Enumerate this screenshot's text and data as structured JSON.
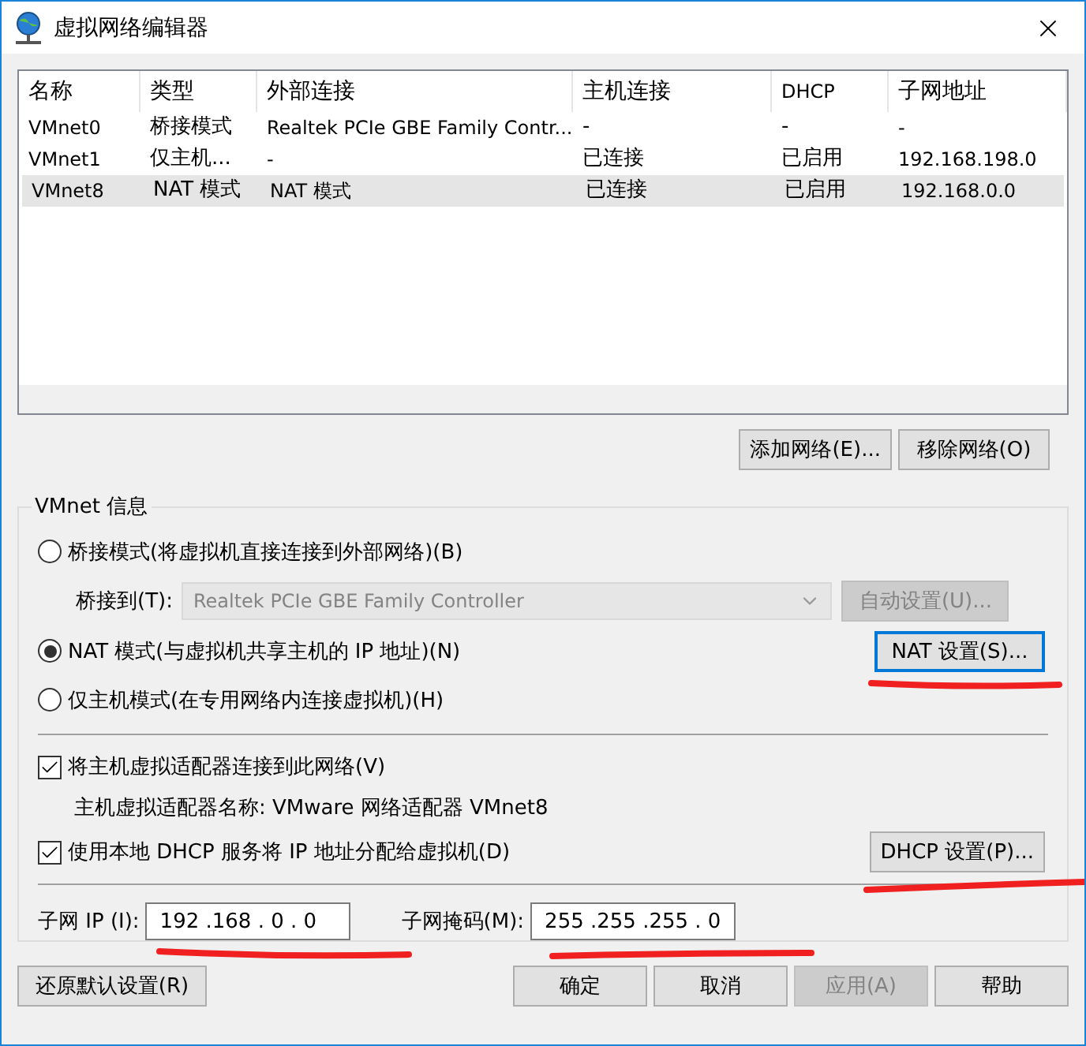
{
  "window": {
    "title": "虚拟网络编辑器"
  },
  "table": {
    "columns": [
      "名称",
      "类型",
      "外部连接",
      "主机连接",
      "DHCP",
      "子网地址"
    ],
    "rows": [
      {
        "cells": [
          "VMnet0",
          "桥接模式",
          "Realtek PCIe GBE Family Contr...",
          "-",
          "-",
          "-"
        ],
        "selected": false
      },
      {
        "cells": [
          "VMnet1",
          "仅主机...",
          "-",
          "已连接",
          "已启用",
          "192.168.198.0"
        ],
        "selected": false
      },
      {
        "cells": [
          "VMnet8",
          "NAT 模式",
          "NAT 模式",
          "已连接",
          "已启用",
          "192.168.0.0"
        ],
        "selected": true
      }
    ]
  },
  "network_buttons": [
    "添加网络(E)...",
    "移除网络(O)"
  ],
  "vmnet_info": {
    "title": "VMnet 信息",
    "modes": [
      {
        "kind": "bridged",
        "label": "桥接模式(将虚拟机直接连接到外部网络)(B)",
        "selected": false
      },
      {
        "kind": "nat",
        "label": "NAT 模式(与虚拟机共享主机的 IP 地址)(N)",
        "selected": true
      },
      {
        "kind": "host_only",
        "label": "仅主机模式(在专用网络内连接虚拟机)(H)",
        "selected": false
      }
    ],
    "bridge_to": {
      "label": "桥接到(T):",
      "value": "Realtek PCIe GBE Family Controller",
      "disabled": true
    },
    "auto_button": {
      "label": "自动设置(U)...",
      "disabled": true
    },
    "nat_button": {
      "label": "NAT 设置(S)...",
      "disabled": false
    },
    "options": [
      {
        "label": "将主机虚拟适配器连接到此网络(V)",
        "checked": true,
        "note": "主机虚拟适配器名称: VMware 网络适配器 VMnet8"
      },
      {
        "label": "使用本地 DHCP 服务将 IP 地址分配给虚拟机(D)",
        "checked": true,
        "button": "DHCP 设置(P)..."
      }
    ],
    "subnet_ip": {
      "label": "子网 IP (I):",
      "value": "192 .168 . 0 . 0"
    },
    "subnet_mask": {
      "label": "子网掩码(M):",
      "value": "255 .255 .255 . 0"
    }
  },
  "footer": {
    "reset_button": {
      "label": "还原默认设置(R)",
      "disabled": false
    },
    "buttons": [
      {
        "label": "确定",
        "disabled": false
      },
      {
        "label": "取消",
        "disabled": false
      },
      {
        "label": "应用(A)",
        "disabled": true
      },
      {
        "label": "帮助",
        "disabled": false
      }
    ]
  }
}
